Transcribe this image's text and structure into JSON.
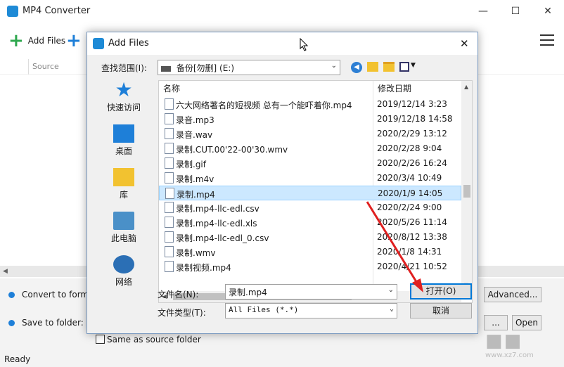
{
  "app": {
    "title": "MP4 Converter",
    "toolbar": {
      "add_files": "Add Files"
    },
    "list_header": {
      "source": "Source"
    },
    "bottom": {
      "convert_to_format": "Convert to format:",
      "save_to_folder": "Save to folder:",
      "advanced": "Advanced...",
      "browse": "...",
      "open": "Open",
      "same_as_source": "Same as source folder",
      "status": "Ready"
    }
  },
  "dialog": {
    "title": "Add Files",
    "look_in_label": "查找范围(I):",
    "look_in_value": "备份[勿删] (E:)",
    "places": [
      {
        "label": "快速访问",
        "icon": "star-icon"
      },
      {
        "label": "桌面",
        "icon": "desktop-icon"
      },
      {
        "label": "库",
        "icon": "library-icon"
      },
      {
        "label": "此电脑",
        "icon": "computer-icon"
      },
      {
        "label": "网络",
        "icon": "network-icon"
      }
    ],
    "columns": {
      "name": "名称",
      "date": "修改日期"
    },
    "files": [
      {
        "name": "六大网络著名的短视频 总有一个能吓着你.mp4",
        "date": "2019/12/14 3:23"
      },
      {
        "name": "录音.mp3",
        "date": "2019/12/18 14:58"
      },
      {
        "name": "录音.wav",
        "date": "2020/2/29 13:12"
      },
      {
        "name": "录制.CUT.00'22-00'30.wmv",
        "date": "2020/2/28 9:04"
      },
      {
        "name": "录制.gif",
        "date": "2020/2/26 16:24"
      },
      {
        "name": "录制.m4v",
        "date": "2020/3/4 10:49"
      },
      {
        "name": "录制.mp4",
        "date": "2020/1/9 14:05"
      },
      {
        "name": "录制.mp4-llc-edl.csv",
        "date": "2020/2/24 9:00"
      },
      {
        "name": "录制.mp4-llc-edl.xls",
        "date": "2020/5/26 11:14"
      },
      {
        "name": "录制.mp4-llc-edl_0.csv",
        "date": "2020/8/12 13:38"
      },
      {
        "name": "录制.wmv",
        "date": "2020/1/8 14:31"
      },
      {
        "name": "录制视频.mp4",
        "date": "2020/4/21 10:52"
      }
    ],
    "selected_index": 6,
    "filename_label": "文件名(N):",
    "filename_value": "录制.mp4",
    "filetype_label": "文件类型(T):",
    "filetype_value": "All Files (*.*)",
    "open_button": "打开(O)",
    "cancel_button": "取消"
  },
  "colors": {
    "accent": "#0078d7",
    "selection": "#cce8ff",
    "plus_green": "#2fa84f",
    "plus_blue": "#1e7fd8",
    "arrow": "#e02020"
  },
  "watermark": "www.xz7.com"
}
